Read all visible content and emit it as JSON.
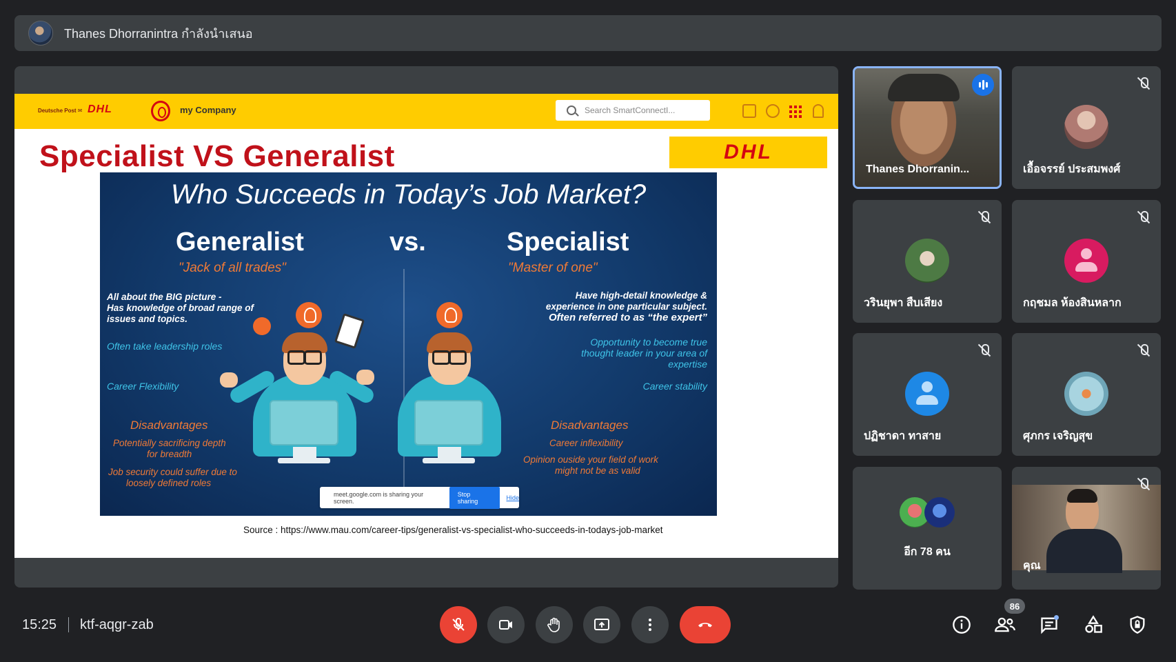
{
  "presenter": {
    "name": "Thanes Dhorranintra กำลังนำเสนอ"
  },
  "slide": {
    "header": {
      "dp_label": "Deutsche Post ✉",
      "dhl_small": "DHL",
      "my_company": "my Company",
      "search_placeholder": "Search SmartConnectI..."
    },
    "title": "Specialist VS Generalist",
    "dhl_logo": "DHL",
    "infographic": {
      "headline": "Who Succeeds in Today’s Job Market?",
      "generalist": {
        "title": "Generalist",
        "subtitle": "\"Jack of all trades\"",
        "desc1": "All about the BIG picture -",
        "desc2": "Has knowledge of broad range of",
        "desc3": "issues and topics.",
        "pro1": "Often take leadership roles",
        "pro2": "Career Flexibility",
        "dis_title": "Disadvantages",
        "dis1": "Potentially sacrificing depth",
        "dis1b": "for breadth",
        "dis2": "Job security could suffer due to",
        "dis2b": "loosely defined roles"
      },
      "vs": "vs.",
      "specialist": {
        "title": "Specialist",
        "subtitle": "\"Master of one\"",
        "desc1": "Have high-detail knowledge &",
        "desc2": "experience in one particular subject.",
        "desc3": "Often referred to as “the expert”",
        "pro1": "Opportunity to become true",
        "pro1b": "thought leader in your area of",
        "pro1c": "expertise",
        "pro2": "Career stability",
        "dis_title": "Disadvantages",
        "dis1": "Career inflexibility",
        "dis2": "Opinion ouside your field of work",
        "dis2b": "might not be as valid"
      }
    },
    "share_bar": {
      "text": "meet.google.com is sharing your screen.",
      "stop": "Stop sharing",
      "hide": "Hide"
    },
    "source": "Source : https://www.mau.com/career-tips/generalist-vs-specialist-who-succeeds-in-todays-job-market"
  },
  "participants": [
    {
      "name": "Thanes Dhorranin...",
      "muted": false,
      "speaking": true,
      "type": "camera"
    },
    {
      "name": "เอื้อจรรย์ ประสมพงศ์",
      "muted": true,
      "type": "photo",
      "color": "#b07a72"
    },
    {
      "name": "วรินยุพา สืบเสียง",
      "muted": true,
      "type": "photo",
      "color": "#4d7a44"
    },
    {
      "name": "กฤชมล ห้องสินหลาก",
      "muted": true,
      "type": "initial-avatar",
      "color": "#d81b60"
    },
    {
      "name": "ปฏิชาดา ทาสาย",
      "muted": true,
      "type": "initial-avatar",
      "color": "#1e88e5"
    },
    {
      "name": "ศุภกร เจริญสุข",
      "muted": true,
      "type": "photo",
      "color": "#6fa6b8"
    },
    {
      "name": "อีก 78 คน",
      "type": "more"
    },
    {
      "name": "คุณ",
      "muted": true,
      "type": "camera"
    }
  ],
  "bottom": {
    "time": "15:25",
    "meeting_code": "ktf-aqgr-zab",
    "people_count": "86"
  },
  "colors": {
    "bg": "#202124",
    "tile": "#3c4043",
    "red": "#ea4335",
    "accent": "#8ab4f8",
    "dhl_yellow": "#ffcc00",
    "dhl_red": "#d40511"
  }
}
